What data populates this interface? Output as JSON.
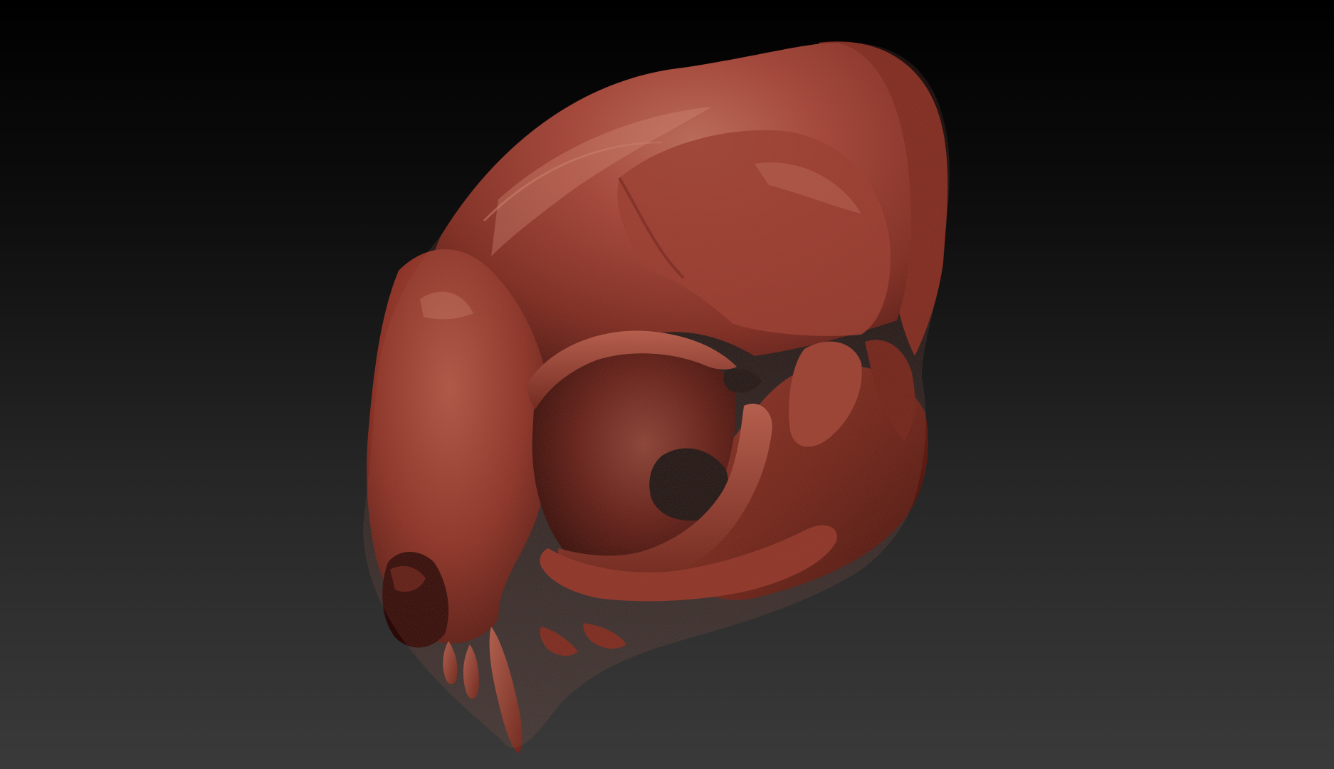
{
  "scene": {
    "subject_icon": "skull-render",
    "background_colors": [
      "#000000",
      "#262626",
      "#3a3a3a"
    ],
    "material_colors": {
      "base": "#9a3a2c",
      "highlight": "#c0705e",
      "mid": "#8a3226",
      "shadow": "#4a1510",
      "deep": "#230806"
    }
  }
}
